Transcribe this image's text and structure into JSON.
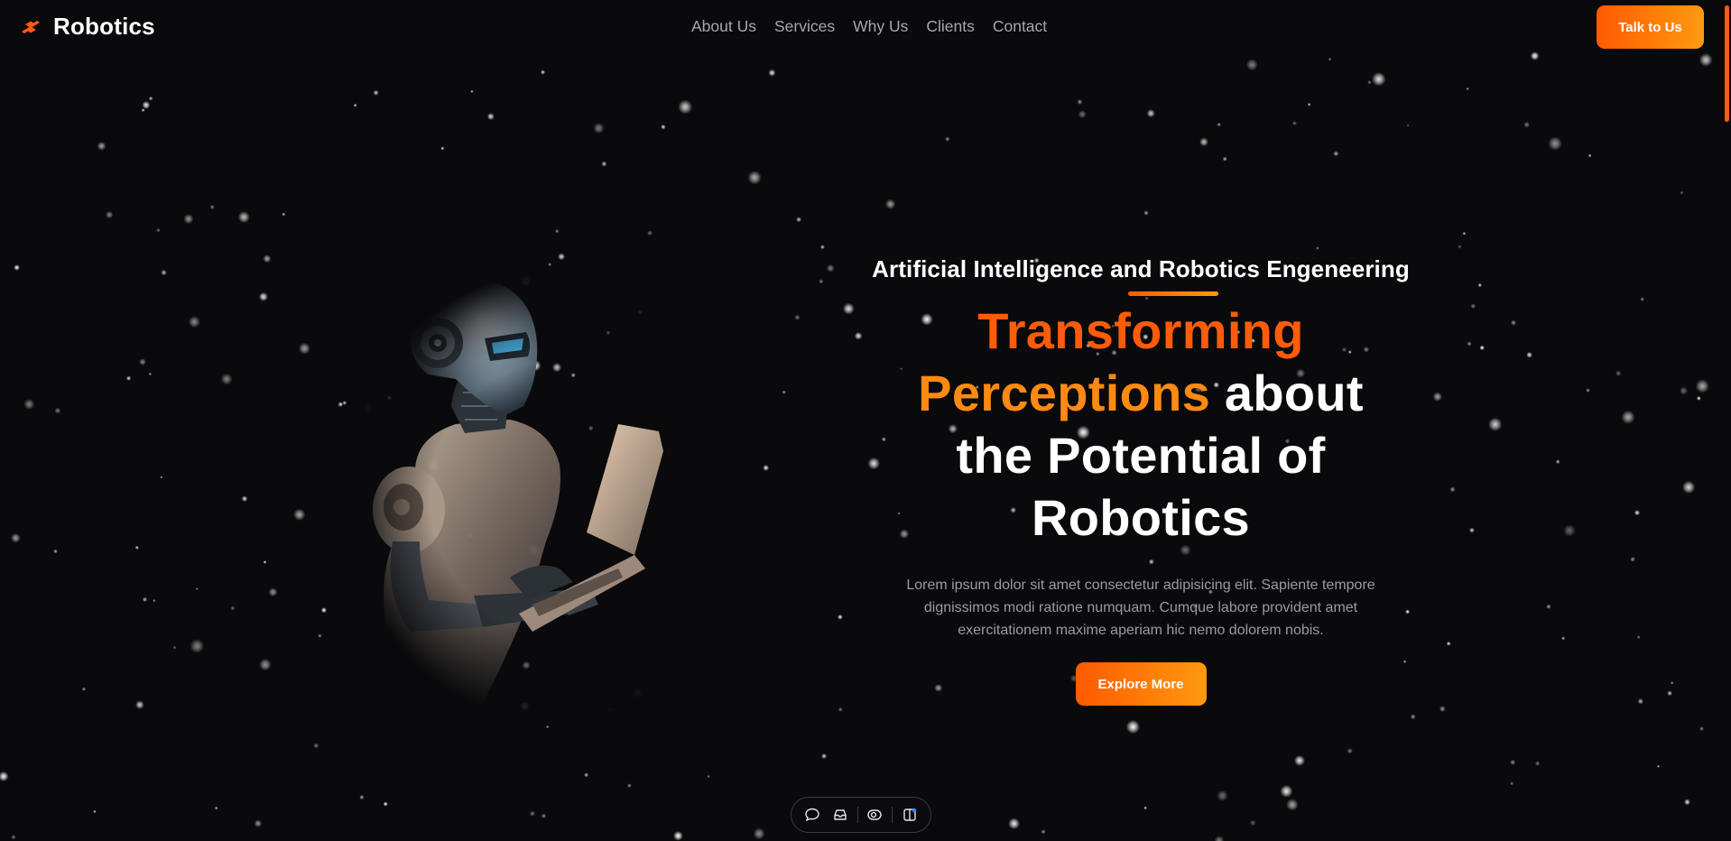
{
  "header": {
    "brand": "Robotics",
    "nav": [
      "About Us",
      "Services",
      "Why Us",
      "Clients",
      "Contact"
    ],
    "cta": "Talk to Us"
  },
  "hero": {
    "eyebrow": "Artificial Intelligence and Robotics Engeneering",
    "headline": {
      "accent1": "Transforming",
      "accent2": "Perceptions",
      "rest1": "about",
      "rest2": "the Potential of",
      "rest3": "Robotics"
    },
    "description": "Lorem ipsum dolor sit amet consectetur adipisicing elit. Sapiente tempore dignissimos modi ratione numquam. Cumque labore provident amet exercitationem maxime aperiam hic nemo dolorem nobis.",
    "cta": "Explore More"
  },
  "toolbar": {
    "icons": [
      "chat-bubble-icon",
      "inbox-icon",
      "eye-toggle-icon",
      "panel-layout-icon"
    ]
  },
  "colors": {
    "background": "#0a0a0c",
    "accent_start": "#ff5a00",
    "accent_end": "#ff9a10",
    "nav_text": "#a6a6ad",
    "body_text": "#9a9aa2"
  }
}
